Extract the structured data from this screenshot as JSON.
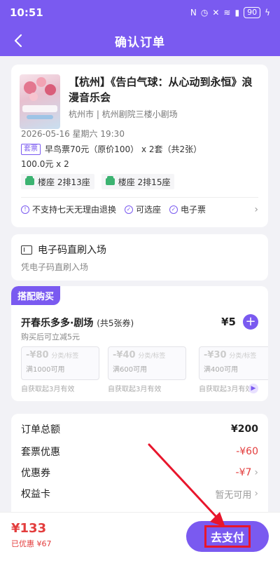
{
  "status": {
    "time": "10:51",
    "battery": "90"
  },
  "nav": {
    "title": "确认订单"
  },
  "event": {
    "title": "【杭州】《告白气球：从心动到永恒》浪漫音乐会",
    "venue": "杭州市 | 杭州剧院三楼小剧场",
    "datetime": "2026-05-16 星期六 19:30",
    "ticket_tag": "套票",
    "ticket_desc": "早鸟票70元（原价100） x 2套（共2张）",
    "price_qty": "100.0元 x 2",
    "seats": [
      "楼座 2排13座",
      "楼座 2排15座"
    ],
    "policies": [
      "不支持七天无理由退换",
      "可选座",
      "电子票"
    ]
  },
  "entry": {
    "title": "电子码直刷入场",
    "subtitle": "凭电子码直刷入场"
  },
  "combo": {
    "label": "搭配购买",
    "name": "开春乐多多·剧场",
    "count": "(共5张券)",
    "price": "¥5",
    "subtitle": "购买后可立减5元",
    "coupons": [
      {
        "amount": "-¥80",
        "unit": "分类/标签",
        "min": "满1000可用",
        "foot": "自获取起3月有效"
      },
      {
        "amount": "-¥40",
        "unit": "分类/标签",
        "min": "满600可用",
        "foot": "自获取起3月有效"
      },
      {
        "amount": "-¥30",
        "unit": "分类/标签",
        "min": "满400可用",
        "foot": "自获取起3月有效"
      }
    ]
  },
  "summary": {
    "total_label": "订单总额",
    "total_value": "¥200",
    "bundle_label": "套票优惠",
    "bundle_value": "-¥60",
    "coupon_label": "优惠券",
    "coupon_value": "-¥7",
    "benefit_label": "权益卡",
    "benefit_value": "暂无可用"
  },
  "footer": {
    "pay_total": "¥133",
    "saved": "已优惠 ¥67",
    "pay_button": "去支付"
  },
  "colors": {
    "brand": "#7a5af0",
    "price": "#e33d3d",
    "highlight": "#e8162c"
  },
  "icons": [
    "back-arrow-icon",
    "nfc-icon",
    "signal-icon",
    "wifi-icon",
    "battery-icon",
    "seat-icon",
    "check-circle-icon",
    "ticket-icon",
    "plus-icon",
    "chevron-right-icon"
  ]
}
